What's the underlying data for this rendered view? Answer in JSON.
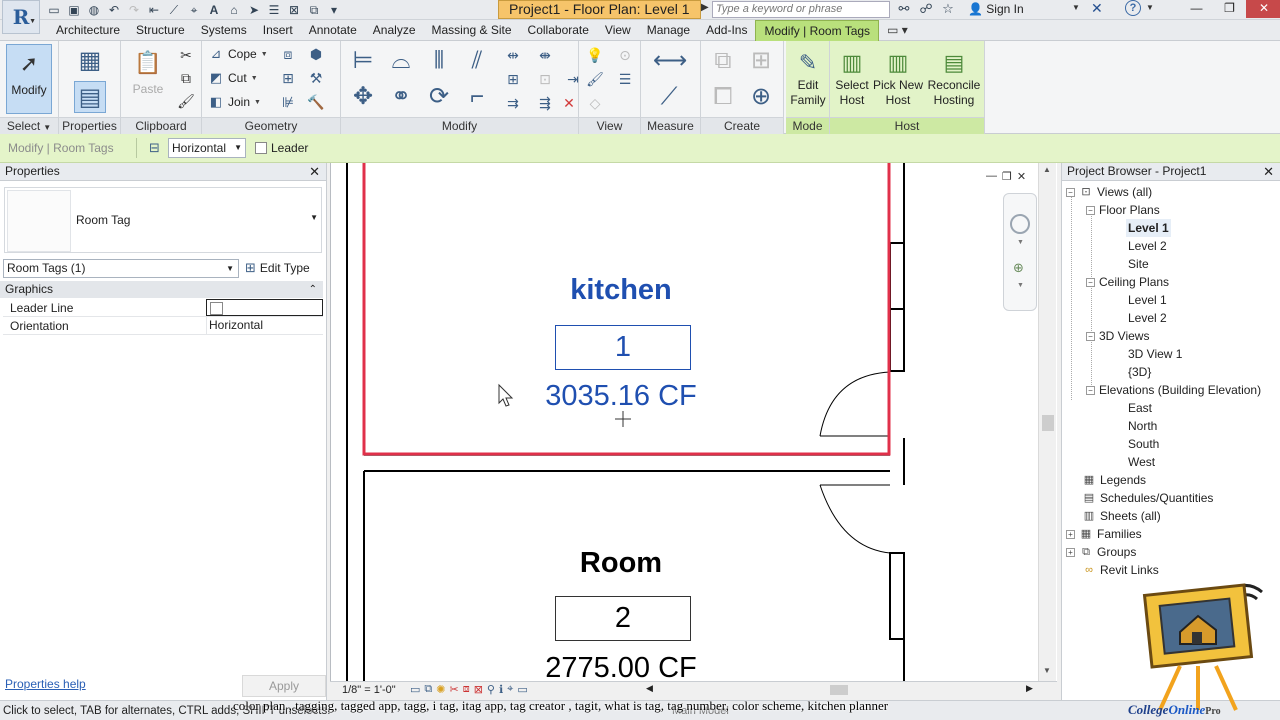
{
  "title_bar": {
    "app_letter": "R",
    "document_title": "Project1 - Floor Plan: Level 1",
    "search_placeholder": "Type a keyword or phrase",
    "sign_in": "Sign In"
  },
  "ribbon_tabs": [
    {
      "label": "Architecture"
    },
    {
      "label": "Structure"
    },
    {
      "label": "Systems"
    },
    {
      "label": "Insert"
    },
    {
      "label": "Annotate"
    },
    {
      "label": "Analyze"
    },
    {
      "label": "Massing & Site"
    },
    {
      "label": "Collaborate"
    },
    {
      "label": "View"
    },
    {
      "label": "Manage"
    },
    {
      "label": "Add-Ins"
    },
    {
      "label": "Modify | Room Tags",
      "active": true
    }
  ],
  "ribbon_panels": {
    "select": {
      "label": "Select",
      "modify_label": "Modify"
    },
    "properties": {
      "label": "Properties"
    },
    "clipboard": {
      "label": "Clipboard",
      "paste_label": "Paste"
    },
    "geometry": {
      "label": "Geometry",
      "cope": "Cope",
      "cut": "Cut",
      "join": "Join"
    },
    "modify": {
      "label": "Modify"
    },
    "view": {
      "label": "View"
    },
    "measure": {
      "label": "Measure"
    },
    "create": {
      "label": "Create"
    },
    "mode": {
      "label": "Mode",
      "edit_family_1": "Edit",
      "edit_family_2": "Family"
    },
    "host": {
      "label": "Host",
      "select_host_1": "Select",
      "select_host_2": "Host",
      "pick_new_host_1": "Pick New",
      "pick_new_host_2": "Host",
      "reconcile_1": "Reconcile",
      "reconcile_2": "Hosting"
    }
  },
  "options_bar": {
    "context_label": "Modify | Room Tags",
    "orientation_value": "Horizontal",
    "leader_label": "Leader",
    "leader_checked": false
  },
  "properties": {
    "title": "Properties",
    "type_name": "Room Tag",
    "instance_filter": "Room Tags (1)",
    "edit_type": "Edit Type",
    "group": "Graphics",
    "rows": [
      {
        "key": "Leader Line",
        "value": ""
      },
      {
        "key": "Orientation",
        "value": "Horizontal"
      }
    ],
    "help_link": "Properties help",
    "apply": "Apply"
  },
  "canvas": {
    "rooms": [
      {
        "name": "kitchen",
        "number": "1",
        "volume": "3035.16 CF",
        "name_color": "#1f4fb0",
        "selected": true
      },
      {
        "name": "Room",
        "number": "2",
        "volume": "2775.00 CF",
        "name_color": "#000000",
        "selected": false
      }
    ],
    "selection_color": "#e0304a",
    "scale": "1/8\" = 1'-0\""
  },
  "project_browser": {
    "title": "Project Browser - Project1",
    "nodes": [
      {
        "label": "Views (all)",
        "depth": 0,
        "toggle": "−",
        "icon": "views-icon"
      },
      {
        "label": "Floor Plans",
        "depth": 1,
        "toggle": "−"
      },
      {
        "label": "Level 1",
        "depth": 2,
        "bold": true
      },
      {
        "label": "Level 2",
        "depth": 2
      },
      {
        "label": "Site",
        "depth": 2
      },
      {
        "label": "Ceiling Plans",
        "depth": 1,
        "toggle": "−"
      },
      {
        "label": "Level 1",
        "depth": 2
      },
      {
        "label": "Level 2",
        "depth": 2
      },
      {
        "label": "3D Views",
        "depth": 1,
        "toggle": "−"
      },
      {
        "label": "3D View 1",
        "depth": 2
      },
      {
        "label": "{3D}",
        "depth": 2
      },
      {
        "label": "Elevations (Building Elevation)",
        "depth": 1,
        "toggle": "−"
      },
      {
        "label": "East",
        "depth": 2
      },
      {
        "label": "North",
        "depth": 2
      },
      {
        "label": "South",
        "depth": 2
      },
      {
        "label": "West",
        "depth": 2
      },
      {
        "label": "Legends",
        "depth": 0,
        "icon": "legends-icon"
      },
      {
        "label": "Schedules/Quantities",
        "depth": 0,
        "icon": "schedules-icon"
      },
      {
        "label": "Sheets (all)",
        "depth": 0,
        "icon": "sheets-icon"
      },
      {
        "label": "Families",
        "depth": 0,
        "toggle": "+",
        "icon": "families-icon"
      },
      {
        "label": "Groups",
        "depth": 0,
        "toggle": "+",
        "icon": "groups-icon"
      },
      {
        "label": "Revit Links",
        "depth": 0,
        "icon": "links-icon"
      }
    ]
  },
  "status_bar": {
    "message": "Click to select, TAB for alternates, CTRL adds, SHIFT unselects.",
    "model": "Main Model"
  },
  "overlay": {
    "caption": "color plan , tagging, tagged app, tagg, i tag, itag app, tag creator , tagit, what is tag, tag number, color scheme, kitchen planner",
    "logo_text_1": "College",
    "logo_text_2": "Online",
    "logo_text_3": "Pro"
  }
}
